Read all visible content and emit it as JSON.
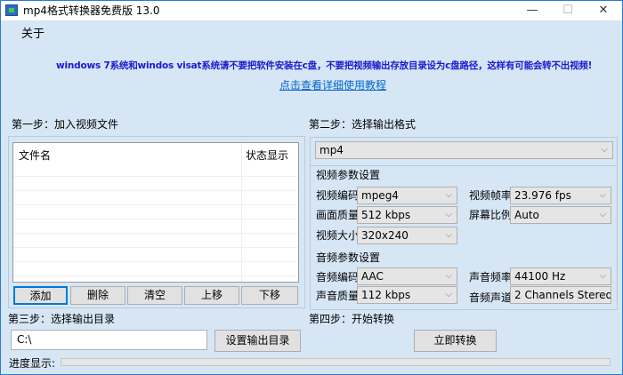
{
  "window": {
    "title": "mp4格式转换器免费版 13.0",
    "minimize": "—",
    "maximize": "☐",
    "close": "✕",
    "accent": "#2b79d0"
  },
  "menu": {
    "about": "关于"
  },
  "notice": {
    "warning": "windows 7系统和windos visat系统请不要把软件安装在c盘，不要把视频输出存放目录设为c盘路径，这样有可能会转不出视频!",
    "tutorial_link": "点击查看详细使用教程",
    "warning_color": "#1a1ad0",
    "link_color": "#0066cc"
  },
  "step1": {
    "label": "第一步：加入视频文件",
    "columns": [
      "文件名",
      "状态显示"
    ],
    "rows": [],
    "buttons": {
      "add": "添加",
      "delete": "删除",
      "clear": "清空",
      "move_up": "上移",
      "move_down": "下移"
    }
  },
  "step2": {
    "label": "第二步：选择输出格式",
    "format": "mp4",
    "video": {
      "header": "视频参数设置",
      "codec_label": "视频编码",
      "codec": "mpeg4",
      "framerate_label": "视频帧率",
      "framerate": "23.976 fps",
      "quality_label": "画面质量",
      "quality": "512 kbps",
      "aspect_label": "屏幕比例",
      "aspect": "Auto",
      "size_label": "视频大小",
      "size": "320x240"
    },
    "audio": {
      "header": "音频参数设置",
      "codec_label": "音频编码",
      "codec": "AAC",
      "samplerate_label": "声音频率",
      "samplerate": "44100 Hz",
      "quality_label": "声音质量",
      "quality": "112 kbps",
      "channels_label": "音频声道",
      "channels": "2 Channels Stereo"
    }
  },
  "step3": {
    "label": "第三步：选择输出目录",
    "path": "C:\\",
    "set_dir_button": "设置输出目录"
  },
  "step4": {
    "label": "第四步：开始转换",
    "convert_button": "立即转换"
  },
  "progress": {
    "label": "进度显示:",
    "value": 0
  }
}
